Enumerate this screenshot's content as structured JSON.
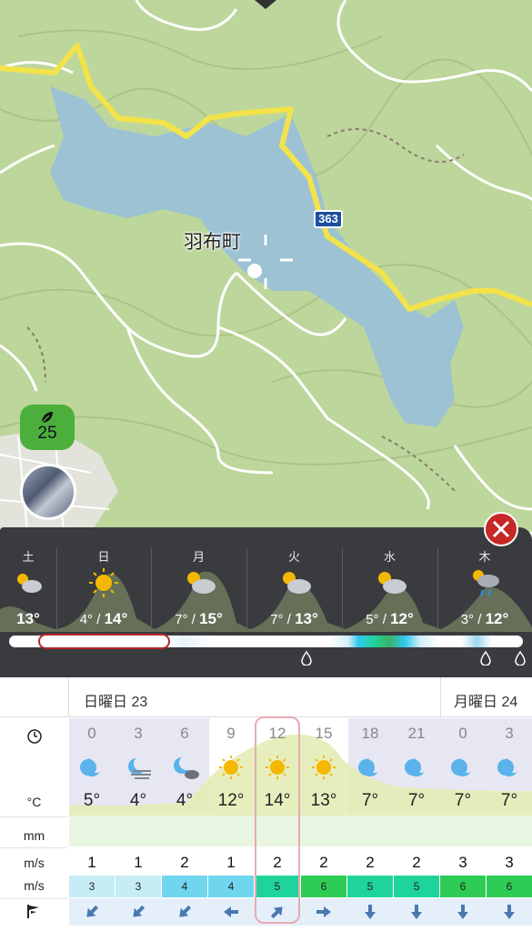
{
  "map": {
    "place_label": "羽布町",
    "road_number": "363",
    "aqi_value": "25"
  },
  "daily": [
    {
      "day": "土",
      "low": "",
      "high": "13°",
      "icon": "partly-cloudy-icon"
    },
    {
      "day": "日",
      "low": "4°",
      "high": "14°",
      "icon": "sun-icon"
    },
    {
      "day": "月",
      "low": "7°",
      "high": "15°",
      "icon": "partly-cloudy-icon"
    },
    {
      "day": "火",
      "low": "7°",
      "high": "13°",
      "icon": "partly-cloudy-icon"
    },
    {
      "day": "水",
      "low": "5°",
      "high": "12°",
      "icon": "partly-cloudy-icon"
    },
    {
      "day": "木",
      "low": "3°",
      "high": "12°",
      "icon": "rain-cloud-icon"
    }
  ],
  "hourly": {
    "date_headers": [
      "日曜日 23",
      "月曜日 24"
    ],
    "row_labels": {
      "temp": "°C",
      "rain": "mm",
      "wind": "m/s",
      "gust": "m/s"
    },
    "columns": [
      {
        "hour": "0",
        "icon": "moon-icon",
        "temp": "5°",
        "wind": "1",
        "gust": "3",
        "dir": "sw"
      },
      {
        "hour": "3",
        "icon": "moon-fog-icon",
        "temp": "4°",
        "wind": "1",
        "gust": "3",
        "dir": "sw"
      },
      {
        "hour": "6",
        "icon": "moon-cloud-icon",
        "temp": "4°",
        "wind": "2",
        "gust": "4",
        "dir": "sw"
      },
      {
        "hour": "9",
        "icon": "sun-icon",
        "temp": "12°",
        "wind": "1",
        "gust": "4",
        "dir": "w"
      },
      {
        "hour": "12",
        "icon": "sun-icon",
        "temp": "14°",
        "wind": "2",
        "gust": "5",
        "dir": "ne"
      },
      {
        "hour": "15",
        "icon": "sun-icon",
        "temp": "13°",
        "wind": "2",
        "gust": "6",
        "dir": "e"
      },
      {
        "hour": "18",
        "icon": "moon-icon",
        "temp": "7°",
        "wind": "2",
        "gust": "5",
        "dir": "s"
      },
      {
        "hour": "21",
        "icon": "moon-icon",
        "temp": "7°",
        "wind": "2",
        "gust": "5",
        "dir": "s"
      },
      {
        "hour": "0",
        "icon": "moon-icon",
        "temp": "7°",
        "wind": "3",
        "gust": "6",
        "dir": "s"
      },
      {
        "hour": "3",
        "icon": "moon-icon",
        "temp": "7°",
        "wind": "3",
        "gust": "6",
        "dir": "s"
      }
    ]
  },
  "colors": {
    "panel": "#3a3b3e",
    "close": "#c62828",
    "selection": "#e8aab2",
    "night": "#e6e7f3",
    "sun": "#f5b800"
  }
}
